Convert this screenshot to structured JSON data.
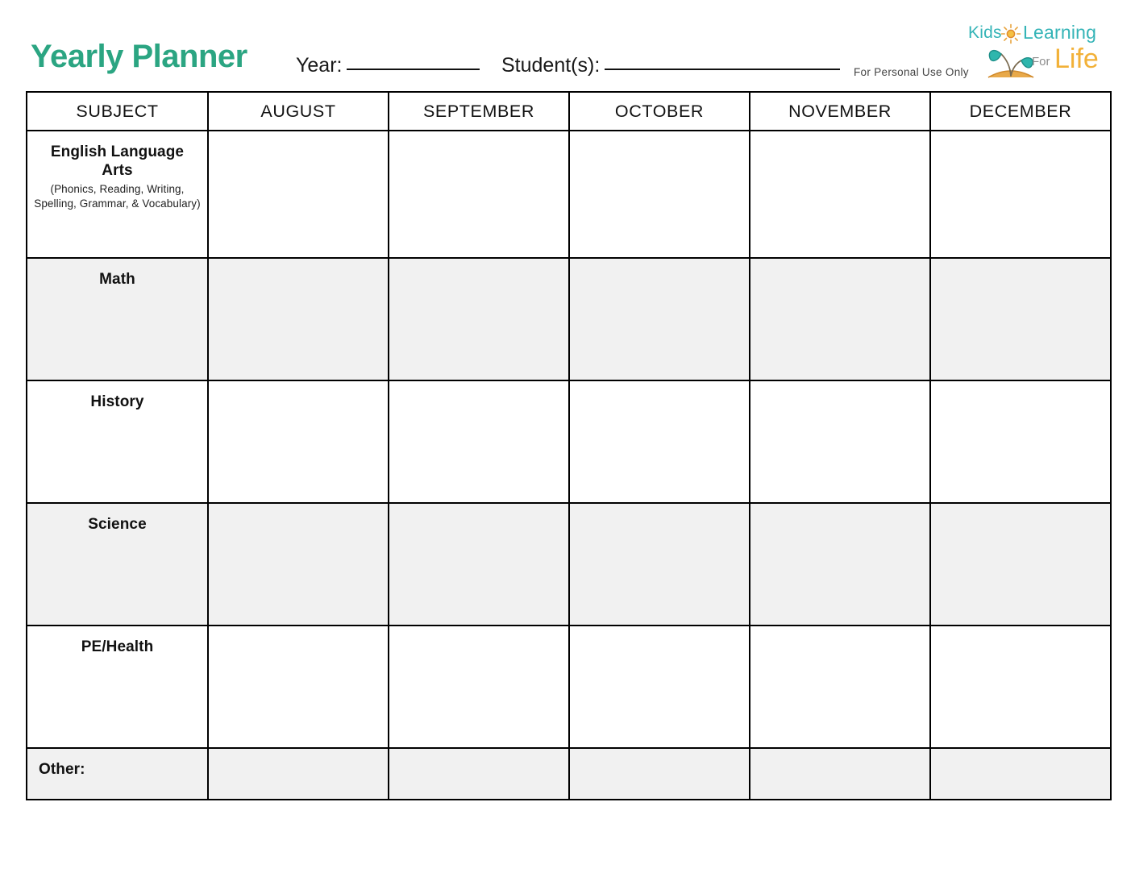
{
  "header": {
    "title": "Yearly Planner",
    "year_label": "Year:",
    "year_value": "",
    "student_label": "Student(s):",
    "student_value": "",
    "personal_use": "For Personal Use Only"
  },
  "logo": {
    "kids": "Kids",
    "learning": "Learning",
    "for": "For",
    "life": "Life",
    "sun_icon": "sun-icon",
    "sprout_icon": "sprout-icon",
    "teal": "#35b4b7",
    "gold": "#f2b138",
    "gray": "#8d8d8d"
  },
  "table": {
    "columns": [
      "SUBJECT",
      "AUGUST",
      "SEPTEMBER",
      "OCTOBER",
      "NOVEMBER",
      "DECEMBER"
    ],
    "rows": [
      {
        "subject": "English Language Arts",
        "subtitle": "(Phonics, Reading, Writing, Spelling, Grammar, & Vocabulary)",
        "shaded": false,
        "align": "center",
        "height": "tall",
        "cells": [
          "",
          "",
          "",
          "",
          ""
        ]
      },
      {
        "subject": "Math",
        "subtitle": "",
        "shaded": true,
        "align": "center",
        "height": "mid",
        "cells": [
          "",
          "",
          "",
          "",
          ""
        ]
      },
      {
        "subject": "History",
        "subtitle": "",
        "shaded": false,
        "align": "center",
        "height": "mid",
        "cells": [
          "",
          "",
          "",
          "",
          ""
        ]
      },
      {
        "subject": "Science",
        "subtitle": "",
        "shaded": true,
        "align": "center",
        "height": "mid",
        "cells": [
          "",
          "",
          "",
          "",
          ""
        ]
      },
      {
        "subject": "PE/Health",
        "subtitle": "",
        "shaded": false,
        "align": "center",
        "height": "mid",
        "cells": [
          "",
          "",
          "",
          "",
          ""
        ]
      },
      {
        "subject": "Other:",
        "subtitle": "",
        "shaded": true,
        "align": "left",
        "height": "short",
        "cells": [
          "",
          "",
          "",
          "",
          ""
        ]
      }
    ]
  },
  "colors": {
    "title_teal": "#2ba582",
    "row_shade": "#f1f1f1",
    "border": "#000000"
  }
}
